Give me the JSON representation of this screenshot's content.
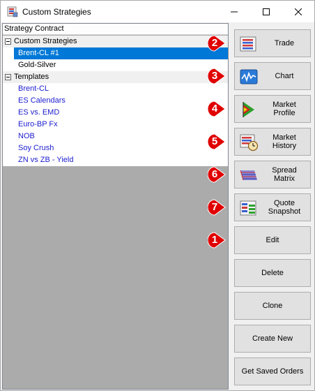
{
  "window": {
    "title": "Custom Strategies"
  },
  "tree": {
    "header": "Strategy Contract",
    "groups": [
      {
        "label": "Custom Strategies",
        "items": [
          "Brent-CL #1",
          "Gold-Silver"
        ]
      },
      {
        "label": "Templates",
        "items": [
          "Brent-CL",
          "ES Calendars",
          "ES vs. EMD",
          "Euro-BP Fx",
          "NOB",
          "Soy Crush",
          "ZN vs ZB - Yield"
        ]
      }
    ],
    "selected": "Brent-CL #1"
  },
  "buttons": {
    "trade": "Trade",
    "chart": "Chart",
    "market_profile": [
      "Market",
      "Profile"
    ],
    "market_history": [
      "Market",
      "History"
    ],
    "spread_matrix": [
      "Spread",
      "Matrix"
    ],
    "quote_snapshot": [
      "Quote",
      "Snapshot"
    ],
    "edit": "Edit",
    "delete": "Delete",
    "clone": "Clone",
    "create_new": "Create New",
    "get_saved_orders": "Get Saved Orders"
  },
  "badges": {
    "trade": "2",
    "chart": "3",
    "market_profile": "4",
    "market_history": "5",
    "spread_matrix": "6",
    "quote_snapshot": "7",
    "edit": "1"
  },
  "colors": {
    "selection": "#0078d7",
    "template_text": "#1c1cd0",
    "badge": "#e00000"
  }
}
